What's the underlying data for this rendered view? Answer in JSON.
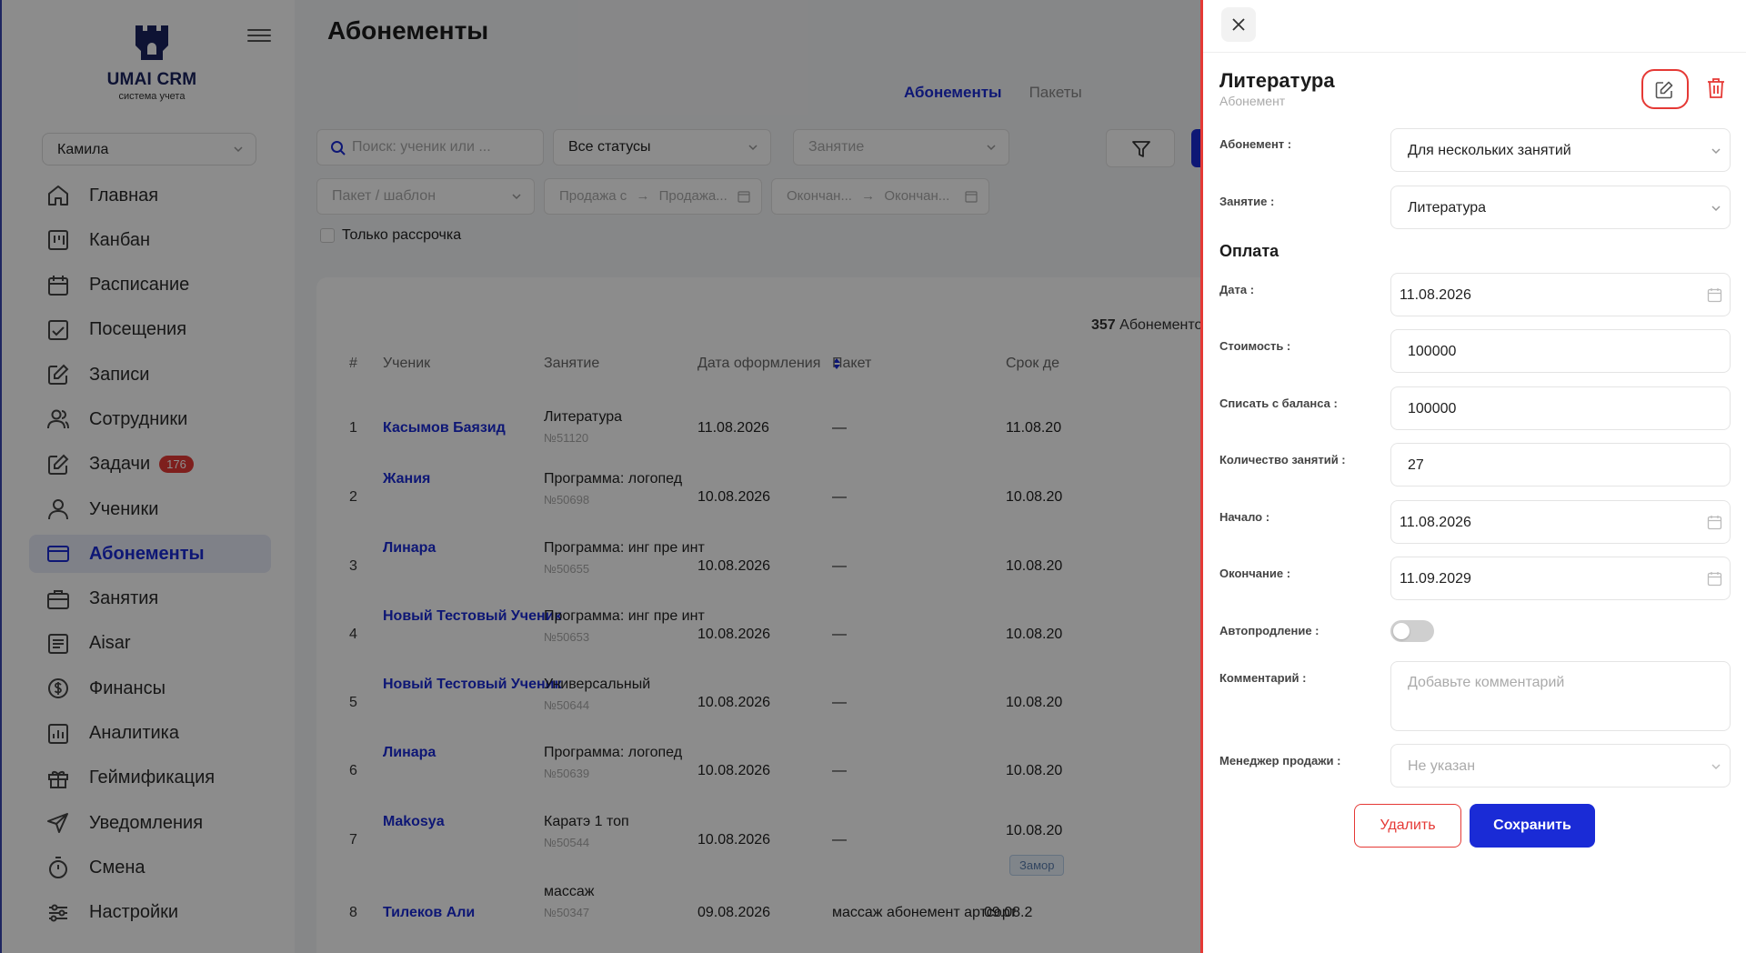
{
  "app": {
    "logo_title": "UMAI CRM",
    "logo_subtitle": "система учета",
    "user": "Камила",
    "colors": {
      "accent": "#1a2bd6",
      "danger": "#e53935"
    }
  },
  "sidebar": {
    "items": [
      {
        "label": "Главная",
        "icon": "home-icon"
      },
      {
        "label": "Канбан",
        "icon": "kanban-icon"
      },
      {
        "label": "Расписание",
        "icon": "calendar-icon"
      },
      {
        "label": "Посещения",
        "icon": "attendance-icon"
      },
      {
        "label": "Записи",
        "icon": "edit-note-icon"
      },
      {
        "label": "Сотрудники",
        "icon": "staff-icon"
      },
      {
        "label": "Задачи",
        "icon": "tasks-icon",
        "badge": "176"
      },
      {
        "label": "Ученики",
        "icon": "student-icon"
      },
      {
        "label": "Абонементы",
        "icon": "card-icon",
        "active": true
      },
      {
        "label": "Занятия",
        "icon": "briefcase-icon"
      },
      {
        "label": "Aisar",
        "icon": "chat-icon"
      },
      {
        "label": "Финансы",
        "icon": "dollar-icon"
      },
      {
        "label": "Аналитика",
        "icon": "chart-icon"
      },
      {
        "label": "Геймификация",
        "icon": "gift-icon"
      },
      {
        "label": "Уведомления",
        "icon": "send-icon"
      },
      {
        "label": "Смена",
        "icon": "timer-icon"
      },
      {
        "label": "Настройки",
        "icon": "sliders-icon"
      }
    ]
  },
  "main": {
    "title": "Абонементы",
    "tabs": [
      {
        "label": "Абонементы",
        "active": true
      },
      {
        "label": "Пакеты",
        "active": false
      }
    ],
    "filters": {
      "search_placeholder": "Поиск: ученик или ...",
      "status": "Все статусы",
      "lesson_placeholder": "Занятие",
      "package_placeholder": "Пакет / шаблон",
      "sale_from": "Продажа с",
      "sale_to": "Продажа...",
      "end_from": "Окончан...",
      "end_to": "Окончан...",
      "installment_only": "Только рассрочка"
    },
    "count_number": "357",
    "count_label": "Абонементов",
    "columns": [
      "#",
      "Ученик",
      "Занятие",
      "Дата оформления",
      "Пакет",
      "Срок де"
    ],
    "rows": [
      {
        "num": "1",
        "student": "Касымов Баязид",
        "lesson": "Литература",
        "code": "№51120",
        "date": "11.08.2026",
        "package": "—",
        "end": "11.08.20"
      },
      {
        "num": "2",
        "student": "Жания",
        "lesson": "Программа: логопед",
        "code": "№50698",
        "date": "10.08.2026",
        "package": "—",
        "end": "10.08.20"
      },
      {
        "num": "3",
        "student": "Линара",
        "lesson": "Программа: инг пре инт",
        "code": "№50655",
        "date": "10.08.2026",
        "package": "—",
        "end": "10.08.20"
      },
      {
        "num": "4",
        "student": "Новый Тестовый Ученик",
        "lesson": "Программа: инг пре инт",
        "code": "№50653",
        "date": "10.08.2026",
        "package": "—",
        "end": "10.08.20"
      },
      {
        "num": "5",
        "student": "Новый Тестовый Ученик",
        "lesson": "Универсальный",
        "code": "№50644",
        "date": "10.08.2026",
        "package": "—",
        "end": "10.08.20"
      },
      {
        "num": "6",
        "student": "Линара",
        "lesson": "Программа: логопед",
        "code": "№50639",
        "date": "10.08.2026",
        "package": "—",
        "end": "10.08.20"
      },
      {
        "num": "7",
        "student": "Makosya",
        "lesson": "Каратэ 1 топ",
        "code": "№50544",
        "date": "10.08.2026",
        "package": "—",
        "end": "10.08.20",
        "badge": "Замор"
      },
      {
        "num": "8",
        "student": "Тилеков Али",
        "lesson": "массаж",
        "code": "№50347",
        "date": "09.08.2026",
        "package": "массаж абонемент артсорт",
        "end": "09.08.2"
      }
    ]
  },
  "drawer": {
    "title": "Литература",
    "subtitle": "Абонемент",
    "fields": {
      "subscription_label": "Абонемент :",
      "subscription_value": "Для нескольких занятий",
      "lesson_label": "Занятие :",
      "lesson_value": "Литература",
      "payment_section": "Оплата",
      "date_label": "Дата :",
      "date_value": "11.08.2026",
      "cost_label": "Стоимость :",
      "cost_value": "100000",
      "balance_label": "Списать с баланса :",
      "balance_value": "100000",
      "lessons_count_label": "Количество занятий :",
      "lessons_count_value": "27",
      "start_label": "Начало :",
      "start_value": "11.08.2026",
      "end_label": "Окончание :",
      "end_value": "11.09.2029",
      "autorenew_label": "Автопродление :",
      "autorenew_on": false,
      "comment_label": "Комментарий :",
      "comment_placeholder": "Добавьте комментарий",
      "manager_label": "Менеджер продажи :",
      "manager_placeholder": "Не указан"
    },
    "delete_label": "Удалить",
    "save_label": "Сохранить"
  }
}
